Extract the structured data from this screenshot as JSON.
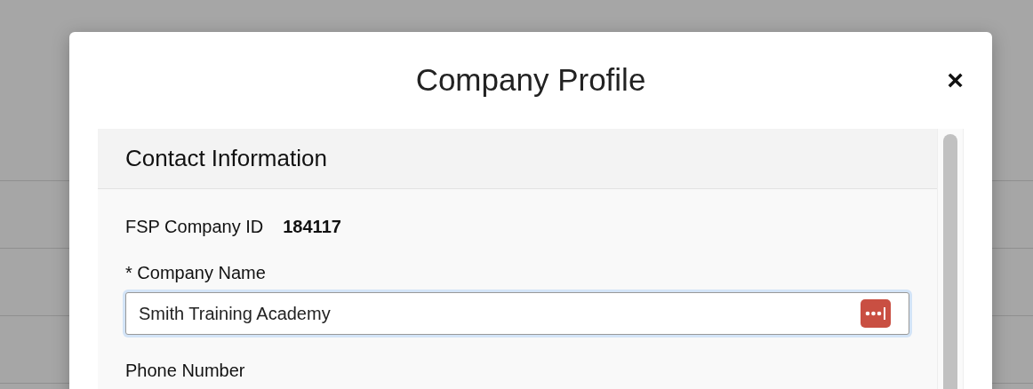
{
  "dialog": {
    "title": "Company Profile",
    "close": "×"
  },
  "section": {
    "title": "Contact Information",
    "company_id": {
      "label": "FSP Company ID",
      "value": "184117"
    },
    "fields": [
      {
        "label": "* Company Name",
        "value": "Smith Training Academy",
        "focused": true
      },
      {
        "label": "Phone Number"
      }
    ]
  }
}
